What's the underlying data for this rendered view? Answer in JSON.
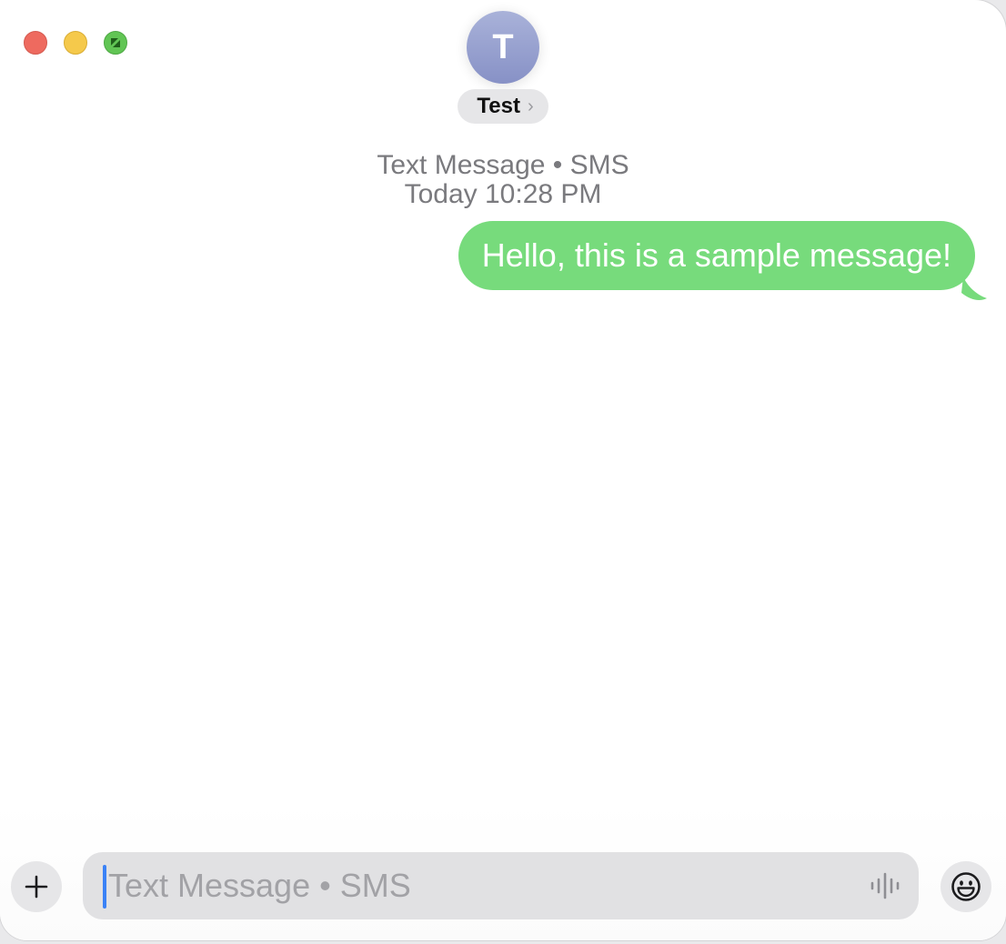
{
  "window": {
    "controls": [
      "close",
      "minimize",
      "fullscreen"
    ]
  },
  "contact": {
    "initial": "T",
    "name": "Test",
    "chevron": "›",
    "avatar_color": "#97a0cf"
  },
  "conversation": {
    "service": "Text Message • SMS",
    "timestamp_day": "Today",
    "timestamp_time": "10:28 PM",
    "messages": [
      {
        "direction": "outgoing",
        "text": "Hello, this is a sample message!",
        "bubble_color": "#77db7c"
      }
    ]
  },
  "compose": {
    "placeholder": "Text Message • SMS",
    "add_icon": "plus-icon",
    "audio_icon": "waveform-icon",
    "emoji_icon": "smiley-icon"
  }
}
